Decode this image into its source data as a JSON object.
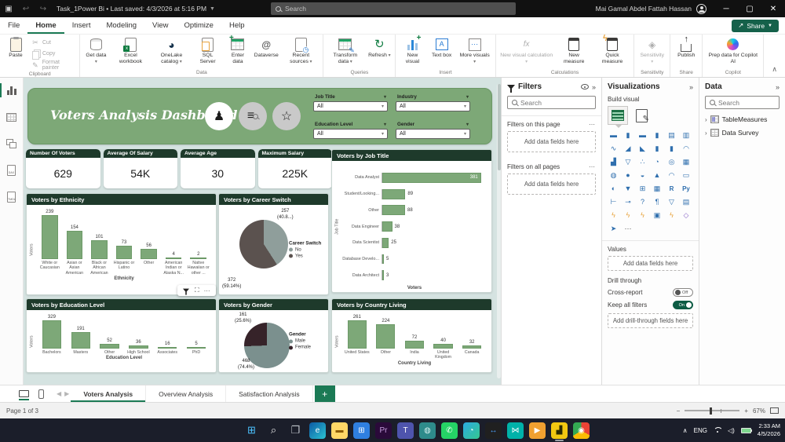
{
  "window": {
    "title": "Task_1Power Bi • Last saved: 4/3/2026 at 5:16 PM",
    "search_placeholder": "Search",
    "user": "Mai Gamal Abdel Fattah Hassan"
  },
  "ribbon": {
    "tabs": [
      "File",
      "Home",
      "Insert",
      "Modeling",
      "View",
      "Optimize",
      "Help"
    ],
    "active_tab": "Home",
    "share_button": "Share",
    "groups": [
      {
        "name": "Clipboard",
        "buttons": [
          {
            "label": "Paste",
            "icon": "paste",
            "type": "big"
          },
          {
            "label": "Cut",
            "icon": "cut",
            "type": "small",
            "disabled": true
          },
          {
            "label": "Copy",
            "icon": "copy",
            "type": "small",
            "disabled": true
          },
          {
            "label": "Format painter",
            "icon": "format-painter",
            "type": "small",
            "disabled": true
          }
        ]
      },
      {
        "name": "Data",
        "buttons": [
          {
            "label": "Get data",
            "icon": "database",
            "type": "big",
            "dropdown": true
          },
          {
            "label": "Excel workbook",
            "icon": "excel",
            "type": "big"
          },
          {
            "label": "OneLake catalog",
            "icon": "onelake",
            "type": "big",
            "dropdown": true
          },
          {
            "label": "SQL Server",
            "icon": "sql-doc",
            "type": "big"
          },
          {
            "label": "Enter data",
            "icon": "enter-data",
            "type": "big"
          },
          {
            "label": "Dataverse",
            "icon": "dataverse",
            "type": "big"
          },
          {
            "label": "Recent sources",
            "icon": "recent",
            "type": "big",
            "dropdown": true
          }
        ]
      },
      {
        "name": "Queries",
        "buttons": [
          {
            "label": "Transform data",
            "icon": "transform",
            "type": "big",
            "dropdown": true
          },
          {
            "label": "Refresh",
            "icon": "refresh",
            "type": "big",
            "dropdown": true
          }
        ]
      },
      {
        "name": "Insert",
        "buttons": [
          {
            "label": "New visual",
            "icon": "new-visual",
            "type": "big"
          },
          {
            "label": "Text box",
            "icon": "text-box",
            "type": "big"
          },
          {
            "label": "More visuals",
            "icon": "more-visuals",
            "type": "big",
            "dropdown": true
          }
        ]
      },
      {
        "name": "Calculations",
        "buttons": [
          {
            "label": "New visual calculation",
            "icon": "visual-calc",
            "type": "big",
            "disabled": true,
            "dropdown": true
          },
          {
            "label": "New measure",
            "icon": "calculator",
            "type": "big"
          },
          {
            "label": "Quick measure",
            "icon": "quick-measure",
            "type": "big"
          }
        ]
      },
      {
        "name": "Sensitivity",
        "buttons": [
          {
            "label": "Sensitivity",
            "icon": "sensitivity",
            "type": "big",
            "disabled": true,
            "dropdown": true
          }
        ]
      },
      {
        "name": "Share",
        "buttons": [
          {
            "label": "Publish",
            "icon": "publish",
            "type": "big"
          }
        ]
      },
      {
        "name": "Copilot",
        "buttons": [
          {
            "label": "Prep data for Copilot AI",
            "icon": "copilot",
            "type": "big",
            "wide": true
          }
        ]
      }
    ]
  },
  "view_rail": [
    "report-view",
    "table-view",
    "model-view",
    "dax-query-view",
    "tmdl-view"
  ],
  "dashboard": {
    "title": "Voters Analysis Dashboard",
    "header_icons": [
      "presenter-icon",
      "search-list-icon",
      "rating-people-icon"
    ],
    "slicers": [
      {
        "label": "Job Title",
        "value": "All"
      },
      {
        "label": "Industry",
        "value": "All"
      },
      {
        "label": "Education Level",
        "value": "All"
      },
      {
        "label": "Gender",
        "value": "All"
      }
    ],
    "kpis": [
      {
        "label": "Number Of Voters",
        "value": "629"
      },
      {
        "label": "Average Of Salary",
        "value": "54K"
      },
      {
        "label": "Average Age",
        "value": "30"
      },
      {
        "label": "Maximum Salary",
        "value": "225K"
      }
    ]
  },
  "chart_data": [
    {
      "id": "job_title",
      "type": "bar-horizontal",
      "title": "Voters by Job Title",
      "xlabel": "Voters",
      "ylabel": "Job Title",
      "bar_color": "#7da878",
      "categories": [
        "Data Analyst",
        "Student/Looking...",
        "Other",
        "Data Engineer",
        "Data Scientist",
        "Database Develo...",
        "Data Architect"
      ],
      "values": [
        381,
        89,
        88,
        38,
        25,
        5,
        3
      ]
    },
    {
      "id": "ethnicity",
      "type": "bar",
      "title": "Voters by Ethnicity",
      "xlabel": "Ethnicity",
      "ylabel": "Voters",
      "bar_color": "#7da878",
      "categories": [
        "White or Caucasian",
        "Asian or Asian American",
        "Black or African American",
        "Hispanic or Latino",
        "Other",
        "American Indian or Alaska N...",
        "Native Hawaiian or other ..."
      ],
      "values": [
        239,
        154,
        101,
        73,
        56,
        4,
        2
      ]
    },
    {
      "id": "career_switch",
      "type": "pie",
      "title": "Voters by Career Switch",
      "legend_title": "Career Switch",
      "slices": [
        {
          "label": "No",
          "value": 257,
          "pct": "(40.8...)",
          "color": "#8f9e9b"
        },
        {
          "label": "Yes",
          "value": 372,
          "pct": "(59.14%)",
          "color": "#5b524f"
        }
      ]
    },
    {
      "id": "education",
      "type": "bar",
      "title": "Voters by Education Level",
      "xlabel": "Education Level",
      "ylabel": "Voters",
      "bar_color": "#7da878",
      "categories": [
        "Bachelors",
        "Masters",
        "Other",
        "High School",
        "Associates",
        "PhD"
      ],
      "values": [
        329,
        191,
        52,
        36,
        16,
        5
      ]
    },
    {
      "id": "gender",
      "type": "pie",
      "title": "Voters by Gender",
      "legend_title": "Gender",
      "slices": [
        {
          "label": "Male",
          "value": 468,
          "pct": "(74.4%)",
          "color": "#7b908e"
        },
        {
          "label": "Female",
          "value": 161,
          "pct": "(25.6%)",
          "color": "#362329"
        }
      ]
    },
    {
      "id": "country",
      "type": "bar",
      "title": "Voters by Country Living",
      "xlabel": "Country Living",
      "ylabel": "Voters",
      "bar_color": "#7da878",
      "categories": [
        "United States",
        "Other",
        "India",
        "United Kingdom",
        "Canada"
      ],
      "values": [
        261,
        224,
        72,
        40,
        32
      ]
    }
  ],
  "filters_pane": {
    "title": "Filters",
    "search_placeholder": "Search",
    "sections": [
      {
        "label": "Filters on this page",
        "placeholder": "Add data fields here"
      },
      {
        "label": "Filters on all pages",
        "placeholder": "Add data fields here"
      }
    ]
  },
  "visualizations_pane": {
    "title": "Visualizations",
    "build_label": "Build visual",
    "gallery_icons": [
      "stacked-bar-chart-icon",
      "stacked-column-chart-icon",
      "clustered-bar-chart-icon",
      "clustered-column-chart-icon",
      "100-stacked-bar-chart-icon",
      "100-stacked-column-chart-icon",
      "line-chart-icon",
      "area-chart-icon",
      "stacked-area-chart-icon",
      "line-and-stacked-column-chart-icon",
      "line-and-clustered-column-chart-icon",
      "ribbon-chart-icon",
      "waterfall-chart-icon",
      "funnel-chart-icon",
      "scatter-chart-icon",
      "pie-chart-icon",
      "donut-chart-icon",
      "treemap-icon",
      "map-icon",
      "filled-map-icon",
      "shape-map-icon",
      "azure-map-icon",
      "gauge-icon",
      "card-icon",
      "multi-row-card-icon",
      "slicer-icon",
      "table-icon",
      "matrix-icon",
      "r-script-visual-icon",
      "python-visual-icon",
      "key-influencers-icon",
      "decomposition-tree-icon",
      "qa-visual-icon",
      "narrative-icon",
      "goals-icon",
      "paginated-report-icon",
      "bolt-card-icon",
      "bolt-gauge-icon",
      "bolt-list-icon",
      "image-visual-icon",
      "bolt-chart-icon",
      "diamond-visual-icon",
      "power-automate-icon",
      "more-options-icon"
    ],
    "values_label": "Values",
    "values_placeholder": "Add data fields here",
    "drill_label": "Drill through",
    "cross_report_label": "Cross-report",
    "cross_report_state": "Off",
    "keep_filters_label": "Keep all filters",
    "keep_filters_state": "On",
    "drill_placeholder": "Add drill-through fields here"
  },
  "data_pane": {
    "title": "Data",
    "search_placeholder": "Search",
    "items": [
      {
        "label": "TableMeasures",
        "icon": "measures-table-icon"
      },
      {
        "label": "Data Survey",
        "icon": "table-icon"
      }
    ]
  },
  "pages_bar": {
    "tabs": [
      "Voters Analysis",
      "Overview Analysis",
      "Satisfaction Analysis"
    ],
    "active_tab": "Voters Analysis",
    "add_label": "+"
  },
  "status_bar": {
    "page_indicator": "Page 1 of 3",
    "zoom": "67%"
  },
  "taskbar": {
    "icons": [
      "start",
      "search",
      "task-view",
      "edge",
      "file-explorer",
      "store",
      "premiere",
      "teams",
      "globe-app",
      "whatsapp",
      "edge-circle",
      "teamviewer",
      "bowtie-app",
      "media-app",
      "power-bi",
      "chrome"
    ],
    "active_icon": "power-bi",
    "tray": {
      "language": "ENG",
      "time": "2:33 AM",
      "date": "4/5/2026"
    }
  }
}
